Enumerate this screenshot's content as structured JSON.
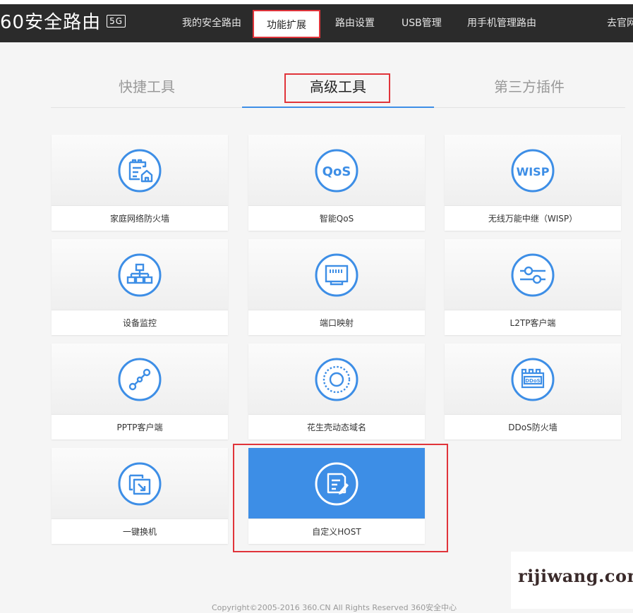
{
  "header": {
    "brand": "60安全路由",
    "badge": "5G",
    "nav": [
      {
        "label": "我的安全路由"
      },
      {
        "label": "功能扩展"
      },
      {
        "label": "路由设置"
      },
      {
        "label": "USB管理"
      },
      {
        "label": "用手机管理路由"
      },
      {
        "label": "去官网"
      }
    ]
  },
  "tabs": [
    {
      "label": "快捷工具"
    },
    {
      "label": "高级工具"
    },
    {
      "label": "第三方插件"
    }
  ],
  "tiles": [
    {
      "label": "家庭网络防火墙",
      "icon": "firewall-home-icon"
    },
    {
      "label": "智能QoS",
      "icon": "qos-icon"
    },
    {
      "label": "无线万能中继（WISP）",
      "icon": "wisp-icon"
    },
    {
      "label": "设备监控",
      "icon": "network-tree-icon"
    },
    {
      "label": "端口映射",
      "icon": "ethernet-port-icon"
    },
    {
      "label": "L2TP客户端",
      "icon": "sliders-icon"
    },
    {
      "label": "PPTP客户端",
      "icon": "link-icon"
    },
    {
      "label": "花生壳动态域名",
      "icon": "peanut-dns-icon"
    },
    {
      "label": "DDoS防火墙",
      "icon": "ddos-firewall-icon"
    },
    {
      "label": "一键换机",
      "icon": "switch-device-icon"
    },
    {
      "label": "自定义HOST",
      "icon": "edit-document-icon"
    }
  ],
  "icon_text": {
    "qos": "QoS",
    "wisp": "WISP",
    "ddos": "DDoS"
  },
  "watermark": "rijiwang.com",
  "footer": {
    "copyright": "Copyright©2005-2016 360.CN All Rights Reserved 360安全中心"
  },
  "colors": {
    "accent": "#3d8ee6",
    "highlight": "#e0343a",
    "nav_bg": "#2b2b2b"
  }
}
